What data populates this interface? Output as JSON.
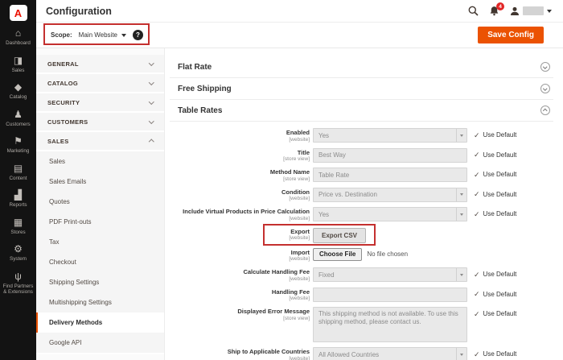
{
  "header": {
    "title": "Configuration",
    "notification_count": "4"
  },
  "logo_letter": "A",
  "scope_bar": {
    "label": "Scope:",
    "value": "Main Website",
    "help_glyph": "?"
  },
  "actions": {
    "save_label": "Save Config"
  },
  "colors": {
    "accent_orange": "#eb5202",
    "annotation_red": "#c4302f",
    "badge_red": "#e22626",
    "sidebar_bg": "#131313"
  },
  "sidebar": {
    "items": [
      {
        "label": "Dashboard",
        "glyph": "⌂"
      },
      {
        "label": "Sales",
        "glyph": "◨"
      },
      {
        "label": "Catalog",
        "glyph": "◆"
      },
      {
        "label": "Customers",
        "glyph": "♟"
      },
      {
        "label": "Marketing",
        "glyph": "⚑"
      },
      {
        "label": "Content",
        "glyph": "▤"
      },
      {
        "label": "Reports",
        "glyph": "▟"
      },
      {
        "label": "Stores",
        "glyph": "▦"
      },
      {
        "label": "System",
        "glyph": "⚙"
      },
      {
        "label": "Find Partners & Extensions",
        "glyph": "ψ"
      }
    ]
  },
  "subnav": {
    "sections": [
      {
        "label": "GENERAL"
      },
      {
        "label": "CATALOG"
      },
      {
        "label": "SECURITY"
      },
      {
        "label": "CUSTOMERS"
      },
      {
        "label": "SALES"
      }
    ],
    "sales_items": [
      "Sales",
      "Sales Emails",
      "Quotes",
      "PDF Print-outs",
      "Tax",
      "Checkout",
      "Shipping Settings",
      "Multishipping Settings",
      "Delivery Methods",
      "Google API"
    ],
    "active_item": "Delivery Methods"
  },
  "main": {
    "sections": [
      {
        "title": "Flat Rate"
      },
      {
        "title": "Free Shipping"
      },
      {
        "title": "Table Rates"
      }
    ],
    "use_default_label": "Use Default",
    "check_glyph": "✓",
    "fields": [
      {
        "label": "Enabled",
        "scope": "[website]",
        "value": "Yes"
      },
      {
        "label": "Title",
        "scope": "[store view]",
        "value": "Best Way"
      },
      {
        "label": "Method Name",
        "scope": "[store view]",
        "value": "Table Rate"
      },
      {
        "label": "Condition",
        "scope": "[website]",
        "value": "Price vs. Destination"
      },
      {
        "label": "Include Virtual Products in Price Calculation",
        "scope": "[website]",
        "value": "Yes"
      },
      {
        "label": "Export",
        "scope": "[website]",
        "value": "Export CSV"
      },
      {
        "label": "Import",
        "scope": "[website]",
        "value": "Choose File",
        "extra": "No file chosen"
      },
      {
        "label": "Calculate Handling Fee",
        "scope": "[website]",
        "value": "Fixed"
      },
      {
        "label": "Handling Fee",
        "scope": "[website]",
        "value": ""
      },
      {
        "label": "Displayed Error Message",
        "scope": "[store view]",
        "value": "This shipping method is not available. To use this shipping method, please contact us."
      },
      {
        "label": "Ship to Applicable Countries",
        "scope": "[website]",
        "value": "All Allowed Countries"
      }
    ]
  }
}
